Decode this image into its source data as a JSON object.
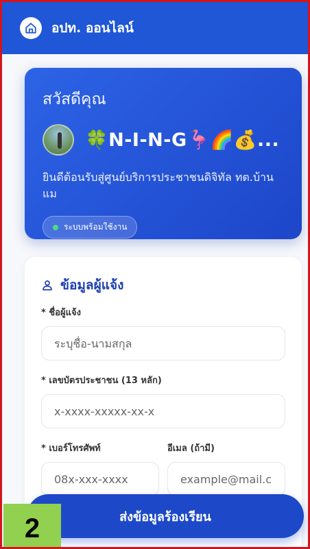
{
  "header": {
    "title": "อปท. ออนไลน์"
  },
  "welcome": {
    "greeting": "สวัสดีคุณ",
    "username": "🍀N-I-N-G🦩🌈💰...",
    "message": "ยินดีต้อนรับสู่ศูนย์บริการประชาชนดิจิทัล ทต.บ้านแม",
    "status": "ระบบพร้อมใช้งาน"
  },
  "form": {
    "section_title": "ข้อมูลผู้แจ้ง",
    "name_label": "* ชื่อผู้แจ้ง",
    "name_placeholder": "ระบุชื่อ-นามสกุล",
    "id_label": "* เลขบัตรประชาชน (13 หลัก)",
    "id_placeholder": "x-xxxx-xxxxx-xx-x",
    "phone_label": "* เบอร์โทรศัพท์",
    "phone_placeholder": "08x-xxx-xxxx",
    "email_label": "อีเมล (ถ้ามี)",
    "email_placeholder": "example@mail.com"
  },
  "actions": {
    "submit_label": "ส่งข้อมูลร้องเรียน"
  },
  "step_badge": "2",
  "colors": {
    "primary": "#1f57d6",
    "frame_border": "#d0161f",
    "badge": "#92d050",
    "status_dot": "#4ade80"
  },
  "icons": {
    "header": "home-icon",
    "section": "person-icon"
  }
}
